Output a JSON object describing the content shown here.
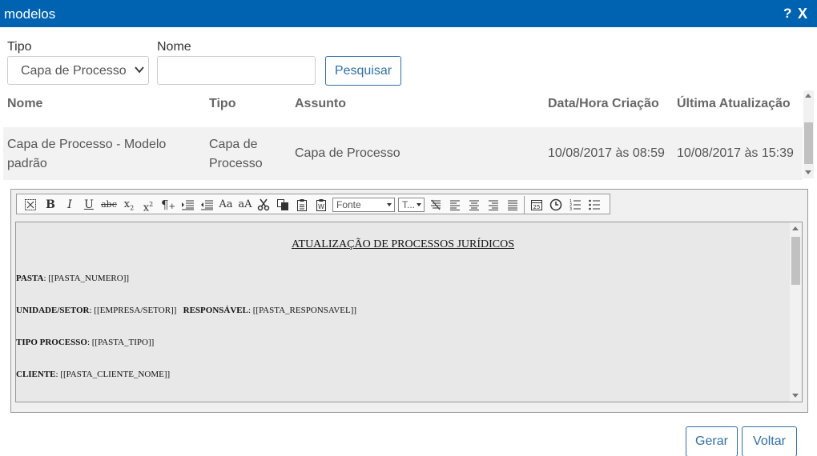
{
  "window": {
    "title": "modelos",
    "help": "?",
    "close": "X"
  },
  "filters": {
    "tipo_label": "Tipo",
    "tipo_value": "Capa de Processo",
    "nome_label": "Nome",
    "nome_value": "",
    "search_button": "Pesquisar"
  },
  "table": {
    "headers": [
      "Nome",
      "Tipo",
      "Assunto",
      "Data/Hora Criação",
      "Última Atualização"
    ],
    "rows": [
      {
        "nome_line1": "Capa de Processo - Modelo",
        "nome_line2": "padrão",
        "tipo_line1": "Capa de",
        "tipo_line2": "Processo",
        "assunto": "Capa de Processo",
        "criacao": "10/08/2017 às 08:59",
        "atualizacao": "10/08/2017 às 15:39"
      }
    ]
  },
  "editor": {
    "toolbar": {
      "font_select": "Fonte",
      "size_select": "T..."
    },
    "icons": [
      "select-all-icon",
      "bold-icon",
      "italic-icon",
      "underline-icon",
      "strikethrough-icon",
      "subscript-icon",
      "superscript-icon",
      "paragraph-icon",
      "indent-icon",
      "outdent-icon",
      "uppercase-icon",
      "lowercase-icon",
      "cut-icon",
      "copy-icon",
      "paste-icon",
      "paste-word-icon",
      "clear-format-icon",
      "align-left-icon",
      "align-center-icon",
      "align-right-icon",
      "justify-icon",
      "date-icon",
      "time-icon",
      "ordered-list-icon",
      "unordered-list-icon"
    ],
    "document": {
      "heading": "ATUALIZAÇÃO DE PROCESSOS JURÍDICOS",
      "pasta_label": "PASTA",
      "pasta_value": ": [[PASTA_NUMERO]]",
      "unidade_label": "UNIDADE/SETOR",
      "unidade_value": ": [[EMPRESA/SETOR]]",
      "responsavel_label": "RESPONSÁVEL",
      "responsavel_value": ": [[PASTA_RESPONSAVEL]]",
      "tipo_label": "TIPO PROCESSO",
      "tipo_value": ": [[PASTA_TIPO]]",
      "cliente_label": "CLIENTE",
      "cliente_value": ": [[PASTA_CLIENTE_NOME]]"
    }
  },
  "footer": {
    "gerar": "Gerar",
    "voltar": "Voltar"
  }
}
